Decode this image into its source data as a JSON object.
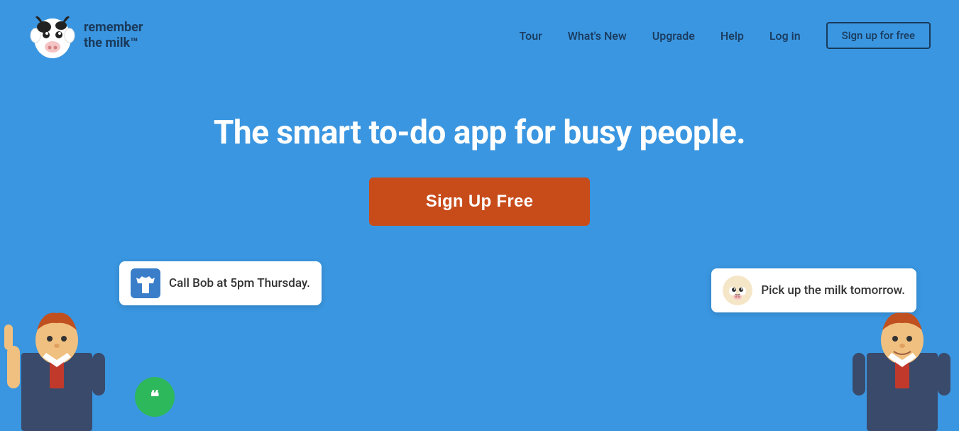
{
  "header": {
    "logo_text_line1": "remember",
    "logo_text_line2": "the milk™",
    "nav": {
      "tour_label": "Tour",
      "whats_new_label": "What's New",
      "upgrade_label": "Upgrade",
      "help_label": "Help",
      "login_label": "Log in",
      "signup_label": "Sign up for free"
    }
  },
  "hero": {
    "headline": "The smart to-do app for busy people.",
    "cta_label": "Sign Up Free"
  },
  "bubbles": {
    "left_text": "Call Bob at 5pm Thursday.",
    "right_text": "Pick up the milk tomorrow."
  },
  "colors": {
    "background": "#3a96e0",
    "cta_bg": "#c84b1a",
    "nav_border": "#1a3a5c",
    "bubble_icon_bg": "#3a7dc9"
  }
}
